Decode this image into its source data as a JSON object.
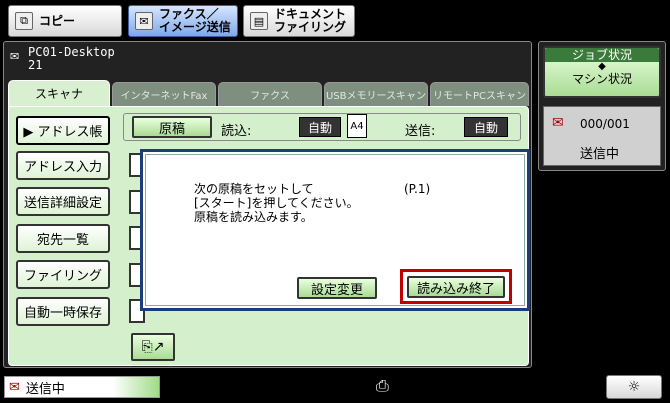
{
  "mode_buttons": [
    {
      "label": "コピー",
      "icon": "copy-icon"
    },
    {
      "label": "ファクス／\nイメージ送信",
      "icon": "fax-icon"
    },
    {
      "label": "ドキュメント\nファイリング",
      "icon": "filing-icon"
    }
  ],
  "header": {
    "line1": "PC01-Desktop",
    "line2": "21"
  },
  "tabs": [
    "スキャナ",
    "インターネットFax",
    "ファクス",
    "USBメモリースキャン",
    "リモートPCスキャン"
  ],
  "sidebar": [
    "▶ アドレス帳",
    "アドレス入力",
    "送信詳細設定",
    "宛先一覧",
    "ファイリング",
    "自動一時保存"
  ],
  "settings": {
    "original_label": "原稿",
    "read_label": "読込:",
    "read_value": "自動",
    "paper_size": "A4",
    "send_label": "送信:",
    "send_value": "自動"
  },
  "dialog": {
    "message_line1": "次の原稿をセットして",
    "page": "(P.1)",
    "message_line2": "[スタート]を押してください。",
    "message_line3": "原稿を読み込みます。",
    "change_settings": "設定変更",
    "finish_reading": "読み込み終了"
  },
  "job": {
    "title": "ジョブ状況",
    "arrow": "◆",
    "subtitle": "マシン状況",
    "count": "000/001",
    "state": "送信中"
  },
  "bottom": {
    "status": "送信中",
    "brightness_icon": "☼"
  },
  "colors": {
    "accent_green": "#a9dc94",
    "dialog_border": "#1d3c7a",
    "highlight_red": "#c00000"
  }
}
